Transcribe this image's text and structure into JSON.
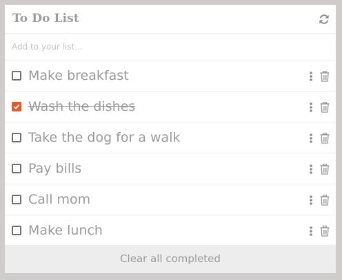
{
  "header": {
    "title": "To Do List",
    "refresh_icon": "refresh-icon"
  },
  "add_input": {
    "placeholder": "Add to your list...",
    "value": ""
  },
  "items": [
    {
      "label": "Make breakfast",
      "done": false
    },
    {
      "label": "Wash the dishes",
      "done": true
    },
    {
      "label": "Take the dog for a walk",
      "done": false
    },
    {
      "label": "Pay bills",
      "done": false
    },
    {
      "label": "Call mom",
      "done": false
    },
    {
      "label": "Make lunch",
      "done": false
    }
  ],
  "item_icons": {
    "menu": "vertical-dots-icon",
    "delete": "trash-icon"
  },
  "footer": {
    "clear_label": "Clear all completed"
  },
  "colors": {
    "accent": "#e15a2a",
    "text": "#9a9a9a",
    "background": "#cfcccb",
    "footer": "#ededed"
  }
}
